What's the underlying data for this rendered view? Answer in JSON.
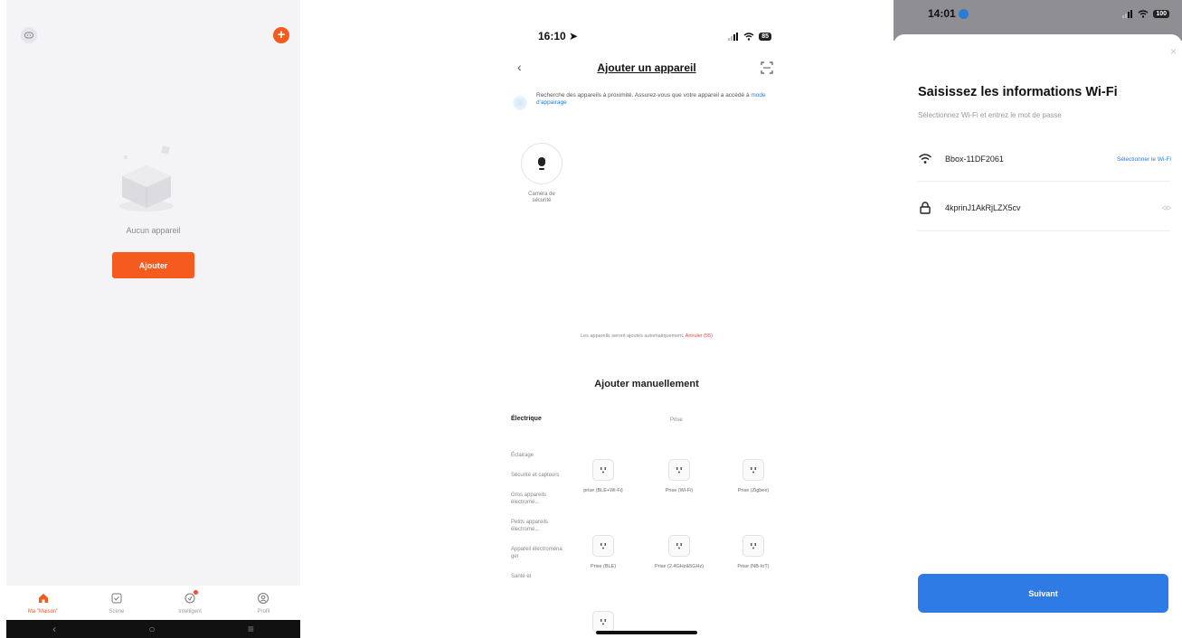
{
  "screen1": {
    "empty_text": "Aucun appareil",
    "add_label": "Ajouter",
    "add_icon": "plus-icon",
    "message_icon": "message-icon",
    "accent_color": "#f55a1e",
    "tabs": [
      {
        "label": "Ma \"Maison\"",
        "icon": "home-icon",
        "active": true
      },
      {
        "label": "Scène",
        "icon": "scene-icon",
        "active": false
      },
      {
        "label": "Intelligent",
        "icon": "smart-icon",
        "active": false
      },
      {
        "label": "Profil",
        "icon": "profile-icon",
        "active": false
      }
    ],
    "nav_glyphs": {
      "back": "‹",
      "home": "○",
      "menu": "≡"
    }
  },
  "screen2": {
    "time": "16:10",
    "battery": "85",
    "title": "Ajouter un appareil",
    "search_text": "Recherche des appareils à proximité. Assurez-vous que votre appareil a accédé à",
    "search_link": "mode d'appairage",
    "found_device": "Caméra de sécurité",
    "auto_text": "Les appareils seront ajoutés automatiquement.",
    "auto_cancel": "Annuler (55)",
    "manual_title": "Ajouter manuellement",
    "category_header": "Électrique",
    "sub_header": "Prise",
    "categories": [
      "Éclairage",
      "Sécurité et capteurs",
      "Gros appareils électromé...",
      "Petits appareils électromé...",
      "Appareil électroména ger",
      "Santé et"
    ],
    "grid": [
      "prise (BLE+Wi-Fi)",
      "Prise (Wi-Fi)",
      "Prise (Zigbee)",
      "Prise (BLE)",
      "Prise (2.4GHz&5GHz)",
      "Prise (NB-IoT)",
      ""
    ]
  },
  "screen3": {
    "time": "14:01",
    "battery": "100",
    "close": "×",
    "title": "Saisissez les informations Wi-Fi",
    "subtitle": "Sélectionnez Wi-Fi et entrez le mot de passe",
    "ssid": "Bbox-11DF2061",
    "select_wifi": "Sélectionner le Wi-Fi",
    "password": "4kprinJ1AkRjLZX5cv",
    "next_label": "Suivant",
    "button_color": "#2f7be6"
  }
}
